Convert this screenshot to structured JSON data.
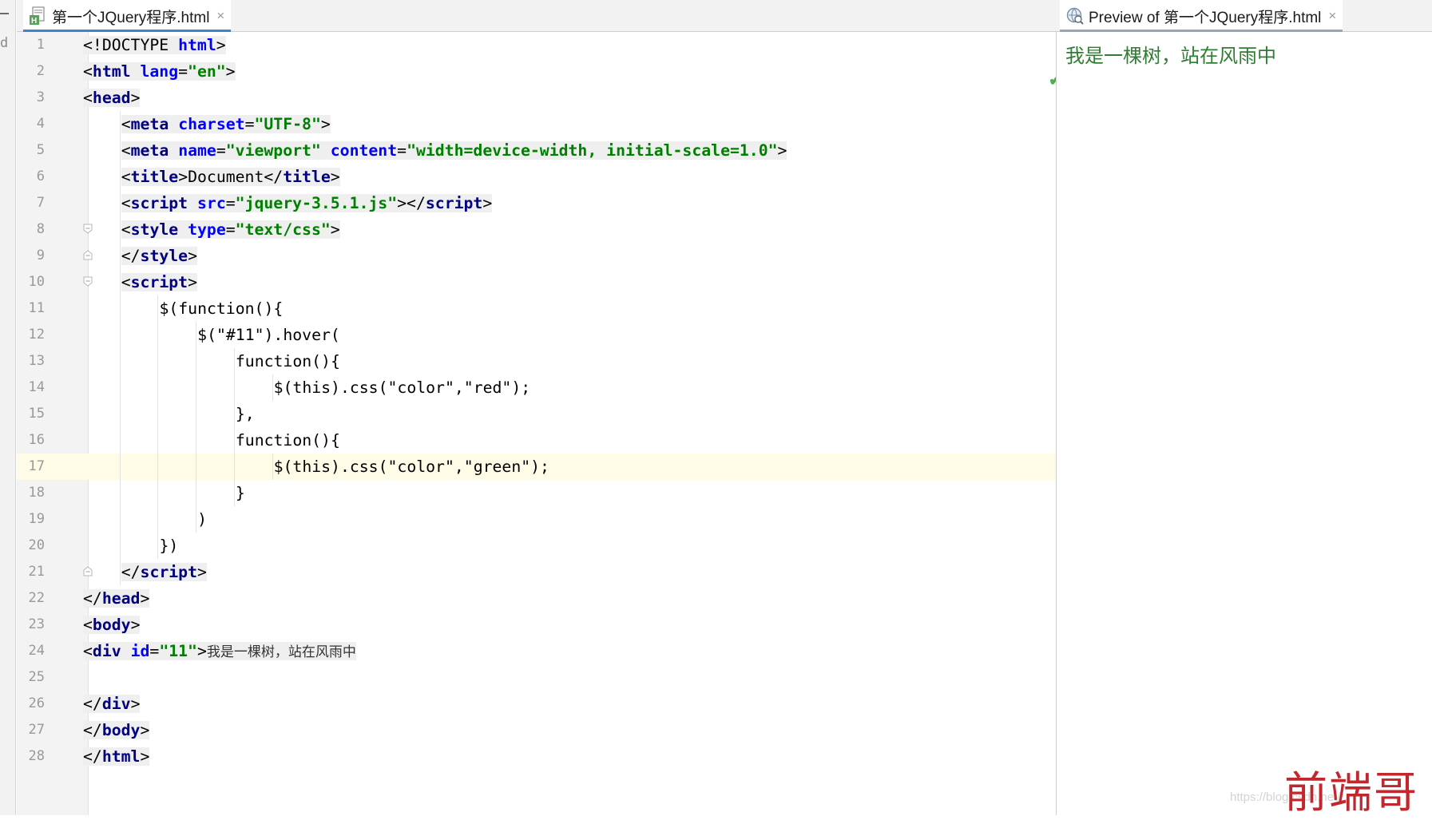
{
  "editor_tab": {
    "label": "第一个JQuery程序.html",
    "close": "×",
    "icon": "html-file-icon"
  },
  "preview_tab": {
    "label": "Preview of 第一个JQuery程序.html",
    "close": "×",
    "icon": "browser-preview-icon"
  },
  "left_strip": {
    "glyph": "d"
  },
  "status": {
    "inspection": "✔"
  },
  "current_line": 17,
  "lines": [
    {
      "n": "1",
      "segs": [
        [
          "tx",
          "<!DOCTYPE "
        ],
        [
          "at",
          "html"
        ],
        [
          "tx",
          ">"
        ]
      ]
    },
    {
      "n": "2",
      "segs": [
        [
          "tx",
          "<"
        ],
        [
          "tg",
          "html "
        ],
        [
          "at",
          "lang"
        ],
        [
          "tx",
          "="
        ],
        [
          "sv",
          "\"en\""
        ],
        [
          "tx",
          ">"
        ]
      ]
    },
    {
      "n": "3",
      "segs": [
        [
          "tx",
          "<"
        ],
        [
          "tg",
          "head"
        ],
        [
          "tx",
          ">"
        ]
      ]
    },
    {
      "n": "4",
      "segs": [
        [
          "tx",
          "<"
        ],
        [
          "tg",
          "meta "
        ],
        [
          "at",
          "charset"
        ],
        [
          "tx",
          "="
        ],
        [
          "sv",
          "\"UTF-8\""
        ],
        [
          "tx",
          ">"
        ]
      ]
    },
    {
      "n": "5",
      "segs": [
        [
          "tx",
          "<"
        ],
        [
          "tg",
          "meta "
        ],
        [
          "at",
          "name"
        ],
        [
          "tx",
          "="
        ],
        [
          "sv",
          "\"viewport\""
        ],
        [
          "tx",
          " "
        ],
        [
          "at",
          "content"
        ],
        [
          "tx",
          "="
        ],
        [
          "sv",
          "\"width=device-width, initial-scale=1.0\""
        ],
        [
          "tx",
          ">"
        ]
      ]
    },
    {
      "n": "6",
      "segs": [
        [
          "tx",
          "<"
        ],
        [
          "tg",
          "title"
        ],
        [
          "tx",
          ">Document</"
        ],
        [
          "tg",
          "title"
        ],
        [
          "tx",
          ">"
        ]
      ]
    },
    {
      "n": "7",
      "segs": [
        [
          "tx",
          "<"
        ],
        [
          "tg",
          "script "
        ],
        [
          "at",
          "src"
        ],
        [
          "tx",
          "="
        ],
        [
          "sv",
          "\"jquery-3.5.1.js\""
        ],
        [
          "tx",
          "></"
        ],
        [
          "tg",
          "script"
        ],
        [
          "tx",
          ">"
        ]
      ]
    },
    {
      "n": "8",
      "segs": [
        [
          "tx",
          "<"
        ],
        [
          "tg",
          "style "
        ],
        [
          "at",
          "type"
        ],
        [
          "tx",
          "="
        ],
        [
          "sv",
          "\"text/css\""
        ],
        [
          "tx",
          ">"
        ]
      ]
    },
    {
      "n": "9",
      "segs": [
        [
          "tx",
          "</"
        ],
        [
          "tg",
          "style"
        ],
        [
          "tx",
          ">"
        ]
      ]
    },
    {
      "n": "10",
      "segs": [
        [
          "tx",
          "<"
        ],
        [
          "tg",
          "script"
        ],
        [
          "tx",
          ">"
        ]
      ]
    },
    {
      "n": "11",
      "segs": [
        [
          "tx",
          "$(function(){"
        ]
      ]
    },
    {
      "n": "12",
      "segs": [
        [
          "tx",
          "$(\"#11\").hover("
        ]
      ]
    },
    {
      "n": "13",
      "segs": [
        [
          "tx",
          "function(){"
        ]
      ]
    },
    {
      "n": "14",
      "segs": [
        [
          "tx",
          "$(this).css(\"color\",\"red\");"
        ]
      ]
    },
    {
      "n": "15",
      "segs": [
        [
          "tx",
          "},"
        ]
      ]
    },
    {
      "n": "16",
      "segs": [
        [
          "tx",
          "function(){"
        ]
      ]
    },
    {
      "n": "17",
      "segs": [
        [
          "tx",
          "$(this).css(\"color\",\"green\");"
        ]
      ]
    },
    {
      "n": "18",
      "segs": [
        [
          "tx",
          "}"
        ]
      ]
    },
    {
      "n": "19",
      "segs": [
        [
          "tx",
          ")"
        ]
      ]
    },
    {
      "n": "20",
      "segs": [
        [
          "tx",
          "})"
        ]
      ]
    },
    {
      "n": "21",
      "segs": [
        [
          "tx",
          "</"
        ],
        [
          "tg",
          "script"
        ],
        [
          "tx",
          ">"
        ]
      ]
    },
    {
      "n": "22",
      "segs": [
        [
          "tx",
          "</"
        ],
        [
          "tg",
          "head"
        ],
        [
          "tx",
          ">"
        ]
      ]
    },
    {
      "n": "23",
      "segs": [
        [
          "tx",
          "<"
        ],
        [
          "tg",
          "body"
        ],
        [
          "tx",
          ">"
        ]
      ]
    },
    {
      "n": "24",
      "segs": [
        [
          "tx",
          "<"
        ],
        [
          "tg",
          "div "
        ],
        [
          "at",
          "id"
        ],
        [
          "tx",
          "="
        ],
        [
          "sv",
          "\"11\""
        ],
        [
          "tx",
          ">"
        ],
        [
          "zh",
          "我是一棵树，站在风雨中"
        ]
      ]
    },
    {
      "n": "25",
      "segs": []
    },
    {
      "n": "26",
      "segs": [
        [
          "tx",
          "</"
        ],
        [
          "tg",
          "div"
        ],
        [
          "tx",
          ">"
        ]
      ]
    },
    {
      "n": "27",
      "segs": [
        [
          "tx",
          "</"
        ],
        [
          "tg",
          "body"
        ],
        [
          "tx",
          ">"
        ]
      ]
    },
    {
      "n": "28",
      "segs": [
        [
          "tx",
          "</"
        ],
        [
          "tg",
          "html"
        ],
        [
          "tx",
          ">"
        ]
      ]
    }
  ],
  "preview": {
    "text": "我是一棵树，站在风雨中"
  },
  "watermark": {
    "text": "前端哥",
    "url": "https://blog.csdn.net/..."
  }
}
